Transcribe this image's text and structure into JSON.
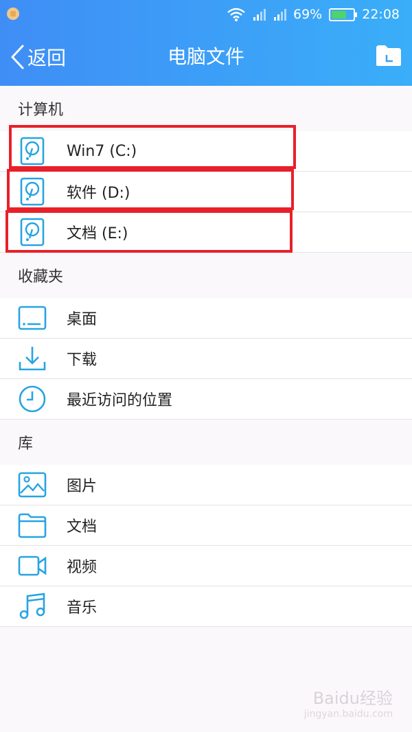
{
  "status_bar": {
    "battery": "69%",
    "battery_level": 0.69,
    "time": "22:08"
  },
  "nav": {
    "back_label": "返回",
    "title": "电脑文件"
  },
  "sections": {
    "computer": {
      "title": "计算机",
      "items": [
        {
          "label": "Win7 (C:)",
          "icon": "hard-drive-icon"
        },
        {
          "label": "软件 (D:)",
          "icon": "hard-drive-icon"
        },
        {
          "label": "文档 (E:)",
          "icon": "hard-drive-icon"
        }
      ]
    },
    "favorites": {
      "title": "收藏夹",
      "items": [
        {
          "label": "桌面",
          "icon": "desktop-icon"
        },
        {
          "label": "下载",
          "icon": "download-icon"
        },
        {
          "label": "最近访问的位置",
          "icon": "clock-icon"
        }
      ]
    },
    "library": {
      "title": "库",
      "items": [
        {
          "label": "图片",
          "icon": "image-icon"
        },
        {
          "label": "文档",
          "icon": "folder-icon"
        },
        {
          "label": "视频",
          "icon": "video-icon"
        },
        {
          "label": "音乐",
          "icon": "music-icon"
        }
      ]
    }
  },
  "watermark": {
    "main": "Baidu经验",
    "sub": "jingyan.baidu.com"
  },
  "colors": {
    "accent": "#27a3e3",
    "header_start": "#3f8ef6",
    "header_end": "#3aaef8",
    "highlight": "#e8202a"
  }
}
